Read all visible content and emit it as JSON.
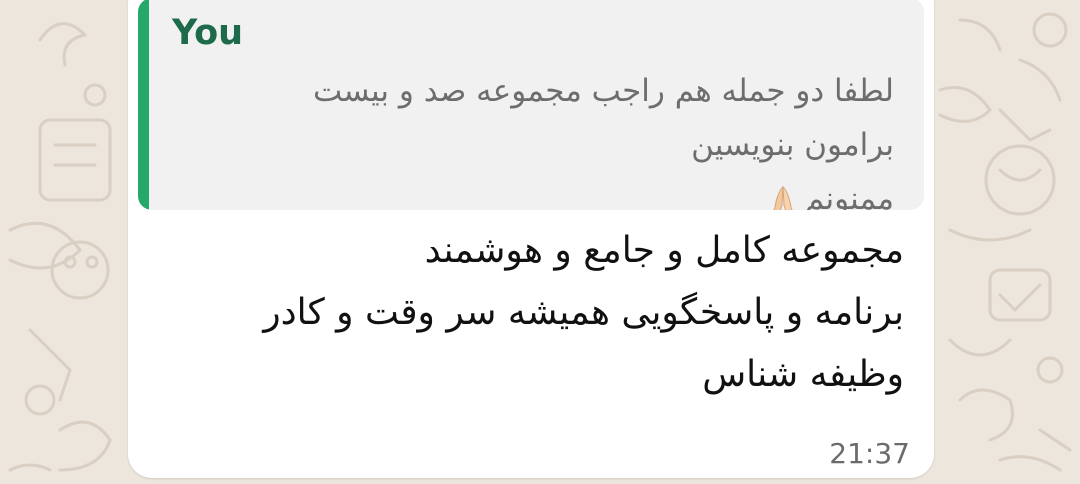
{
  "message": {
    "quoted": {
      "author": "You",
      "lines": [
        "لطفا دو جمله هم راجب مجموعه صد و بیست",
        "برامون بنویسین",
        "ممنونم"
      ],
      "emoji_icon": "folded-hands-icon"
    },
    "body_lines": [
      "مجموعه کامل و جامع و هوشمند",
      "برنامه و پاسخگویی همیشه سر وقت و کادر",
      "وظیفه شناس"
    ],
    "time": "21:37"
  },
  "colors": {
    "background": "#ede6dc",
    "bubble": "#ffffff",
    "quote_bg": "#f1f1f1",
    "quote_bar": "#25a96a",
    "quote_author": "#1d6b4a"
  }
}
